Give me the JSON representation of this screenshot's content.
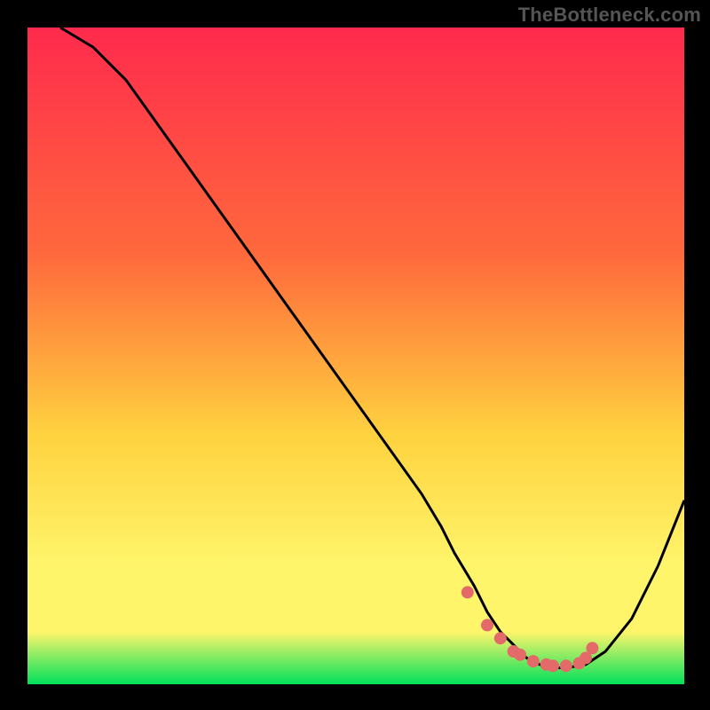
{
  "attribution": "TheBottleneck.com",
  "colors": {
    "bg": "#000000",
    "grad_top": "#ff2a4d",
    "grad_mid1": "#ff6a3c",
    "grad_mid2": "#ffd23f",
    "grad_mid3": "#fff56b",
    "grad_bottom": "#00e05a",
    "curve": "#000000",
    "dots": "#e46a6a"
  },
  "chart_data": {
    "type": "line",
    "title": "",
    "xlabel": "",
    "ylabel": "",
    "xlim": [
      0,
      100
    ],
    "ylim": [
      0,
      100
    ],
    "series": [
      {
        "name": "curve",
        "x": [
          5,
          10,
          15,
          20,
          25,
          30,
          35,
          40,
          45,
          50,
          55,
          60,
          63,
          65,
          68,
          70,
          72,
          74,
          76,
          78,
          80,
          82,
          85,
          88,
          92,
          96,
          100
        ],
        "y": [
          100,
          97,
          92,
          85,
          78,
          71,
          64,
          57,
          50,
          43,
          36,
          29,
          24,
          20,
          15,
          11,
          8,
          6,
          4,
          3,
          2.5,
          2.5,
          3,
          5,
          10,
          18,
          28
        ]
      }
    ],
    "dots": {
      "name": "highlight",
      "x": [
        67,
        70,
        72,
        74,
        75,
        77,
        79,
        80,
        82,
        84,
        85,
        86
      ],
      "y": [
        14,
        9,
        7,
        5,
        4.5,
        3.5,
        3,
        2.8,
        2.8,
        3.2,
        4,
        5.5
      ]
    }
  }
}
